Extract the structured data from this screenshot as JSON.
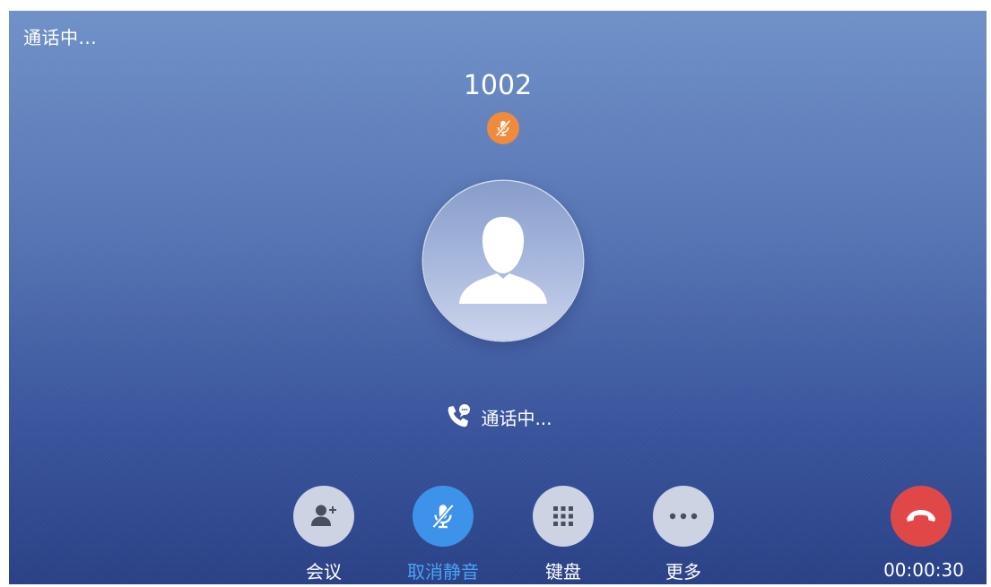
{
  "header": {
    "status_title": "通话中..."
  },
  "caller": {
    "number": "1002",
    "muted_icon": "mic-off-icon",
    "avatar_icon": "person-avatar-icon"
  },
  "call_state": {
    "icon": "phone-talk-icon",
    "text": "通话中..."
  },
  "controls": [
    {
      "id": "conference",
      "label": "会议",
      "icon": "add-person-icon",
      "active": false
    },
    {
      "id": "unmute",
      "label": "取消静音",
      "icon": "mic-off-icon",
      "active": true
    },
    {
      "id": "keypad",
      "label": "键盘",
      "icon": "keypad-icon",
      "active": false
    },
    {
      "id": "more",
      "label": "更多",
      "icon": "more-dots-icon",
      "active": false
    }
  ],
  "hangup": {
    "icon": "hang-up-icon"
  },
  "timer": "00:00:30",
  "colors": {
    "bg_top": "#7091c8",
    "bg_bottom": "#2a4186",
    "button_bg": "#cdd3e3",
    "active_blue": "#3d92ea",
    "active_label": "#4aa2f4",
    "muted_orange": "#f08b3c",
    "hangup_red": "#e04848"
  }
}
